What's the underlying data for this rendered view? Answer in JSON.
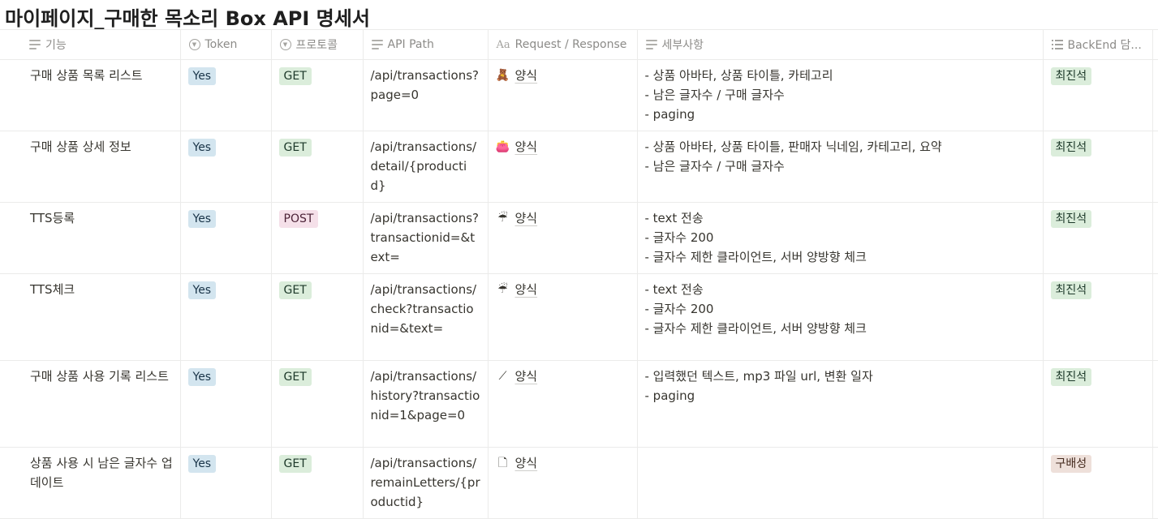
{
  "page": {
    "title": "마이페이지_구매한 목소리 Box API 명세서"
  },
  "columns": {
    "feature": "기능",
    "token": "Token",
    "protocol": "프로토콜",
    "path": "API Path",
    "reqres": "Request / Response",
    "details": "세부사항",
    "owner": "BackEnd 담..."
  },
  "rows": [
    {
      "feature": "구매 상품 목록 리스트",
      "token": "Yes",
      "protocol": "GET",
      "path": "/api/transactions?page=0",
      "reqres_icon": "🧸",
      "reqres_icon_name": "teddy-bear-icon",
      "reqres": "양식",
      "details": [
        "- 상품 아바타, 상품 타이틀, 카테고리",
        "- 남은 글자수 / 구매 글자수",
        "- paging"
      ],
      "owner": "최진석",
      "owner_color": "green"
    },
    {
      "feature": "구매 상품 상세 정보",
      "token": "Yes",
      "protocol": "GET",
      "path": "/api/transactions/detail/{productid}",
      "reqres_icon": "👛",
      "reqres_icon_name": "purse-icon",
      "reqres": "양식",
      "details": [
        "- 상품 아바타, 상품 타이틀, 판매자 닉네임, 카테고리, 요약",
        "- 남은 글자수 / 구매 글자수"
      ],
      "owner": "최진석",
      "owner_color": "green"
    },
    {
      "feature": "TTS등록",
      "token": "Yes",
      "protocol": "POST",
      "path": "/api/transactions?transactionid=&text=",
      "reqres_icon": "☔",
      "reqres_icon_name": "umbrella-icon",
      "reqres": "양식",
      "details": [
        "- text 전송",
        "- 글자수 200",
        "- 글자수 제한 클라이언트, 서버 양방향 체크"
      ],
      "owner": "최진석",
      "owner_color": "green"
    },
    {
      "feature": "TTS체크",
      "token": "Yes",
      "protocol": "GET",
      "path": "/api/transactions/check?transactionid=&text=",
      "reqres_icon": "☔",
      "reqres_icon_name": "umbrella-icon",
      "reqres": "양식",
      "details": [
        "- text 전송",
        "- 글자수 200",
        "- 글자수 제한 클라이언트, 서버 양방향 체크"
      ],
      "owner": "최진석",
      "owner_color": "green"
    },
    {
      "feature": "구매 상품 사용 기록 리스트",
      "token": "Yes",
      "protocol": "GET",
      "path": "/api/transactions/history?transactionid=1&page=0",
      "reqres_icon": "⟋",
      "reqres_icon_name": "wand-icon",
      "reqres": "양식",
      "details": [
        "- 입력했던 텍스트, mp3 파일 url, 변환 일자",
        "- paging"
      ],
      "owner": "최진석",
      "owner_color": "green"
    },
    {
      "feature": "상품 사용 시 남은 글자수 업데이트",
      "token": "Yes",
      "protocol": "GET",
      "path": "/api/transactions/remainLetters/{productid}",
      "reqres_icon": "🗋",
      "reqres_icon_name": "document-icon",
      "reqres": "양식",
      "details": [],
      "owner": "구배성",
      "owner_color": "brown"
    }
  ]
}
